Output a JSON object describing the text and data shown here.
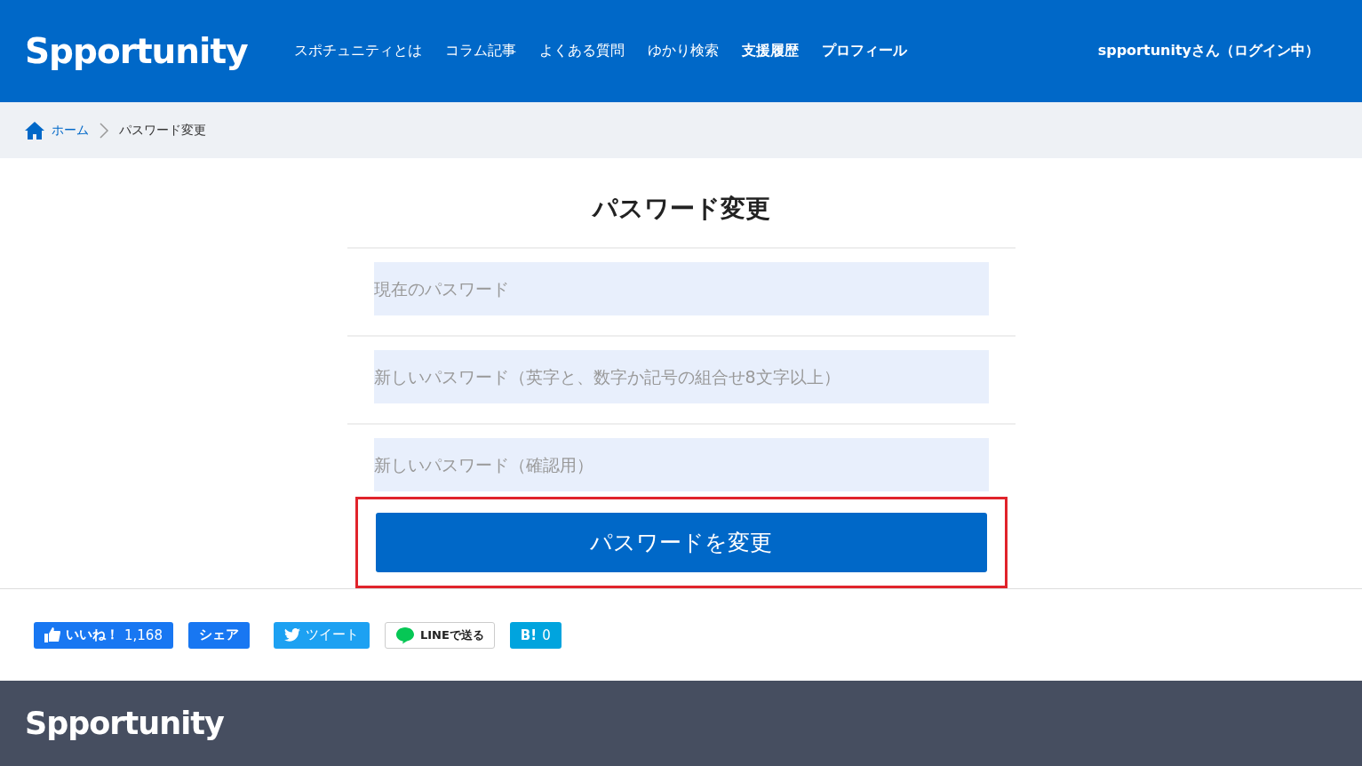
{
  "header": {
    "logo": "Spportunity",
    "nav": [
      {
        "label": "スポチュニティとは",
        "emphasized": false
      },
      {
        "label": "コラム記事",
        "emphasized": false
      },
      {
        "label": "よくある質問",
        "emphasized": false
      },
      {
        "label": "ゆかり検索",
        "emphasized": false
      },
      {
        "label": "支援履歴",
        "emphasized": true
      },
      {
        "label": "プロフィール",
        "emphasized": true
      }
    ],
    "user": "spportunityさん（ログイン中）"
  },
  "breadcrumb": [
    {
      "label": "ホーム",
      "kind": "home"
    },
    {
      "label": "パスワード変更",
      "kind": "current"
    }
  ],
  "page_title": "パスワード変更",
  "fields": [
    {
      "placeholder": "現在のパスワード"
    },
    {
      "placeholder": "新しいパスワード（英字と、数字か記号の組合せ8文字以上）"
    },
    {
      "placeholder": "新しいパスワード（確認用）"
    }
  ],
  "submit": {
    "label": "パスワードを変更",
    "highlighted": true
  },
  "share_buttons": [
    {
      "kind": "like",
      "label": "いいね！",
      "count": "1,168"
    },
    {
      "kind": "share",
      "label": "シェア"
    },
    {
      "kind": "tweet",
      "label": "ツイート"
    },
    {
      "kind": "line",
      "label": "LINEで送る"
    },
    {
      "kind": "hatena",
      "label": "B!",
      "count": "0"
    }
  ],
  "footer": {
    "logo": "Spportunity"
  }
}
